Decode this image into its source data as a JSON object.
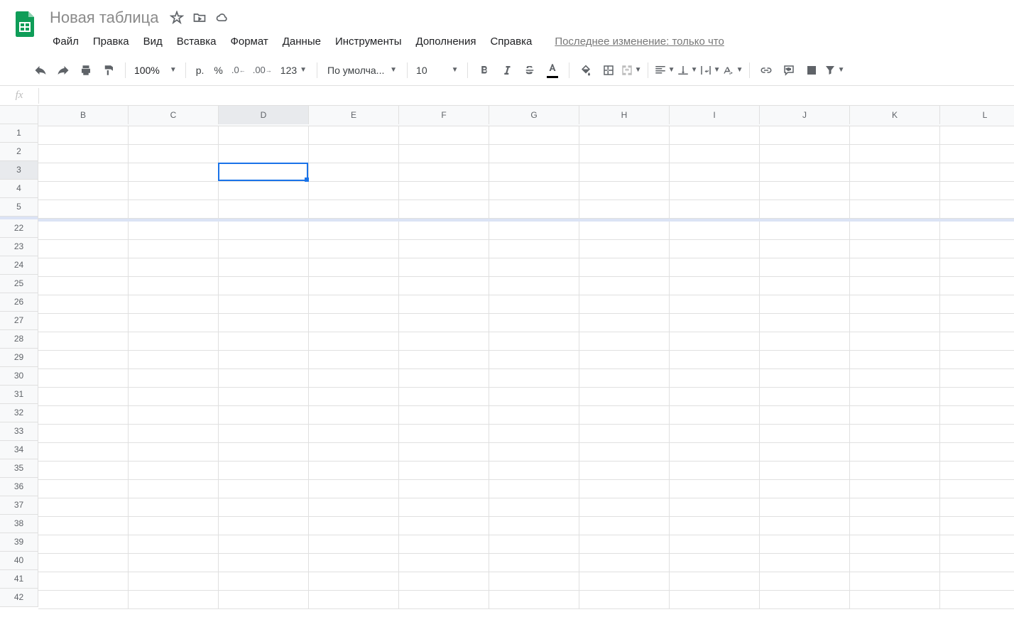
{
  "doc": {
    "title": "Новая таблица"
  },
  "menus": {
    "file": "Файл",
    "edit": "Правка",
    "view": "Вид",
    "insert": "Вставка",
    "format": "Формат",
    "data": "Данные",
    "tools": "Инструменты",
    "addons": "Дополнения",
    "help": "Справка",
    "last_change": "Последнее изменение: только что"
  },
  "toolbar": {
    "zoom": "100%",
    "currency_symbol": "р.",
    "percent": "%",
    "dec_minus": ".0",
    "dec_plus": ".00",
    "num_format": "123",
    "font_name": "По умолча...",
    "font_size": "10"
  },
  "fx": {
    "label": "fx",
    "value": ""
  },
  "columns": [
    "B",
    "C",
    "D",
    "E",
    "F",
    "G",
    "H",
    "I",
    "J",
    "K",
    "L"
  ],
  "rows_top": [
    "1",
    "2",
    "3",
    "4",
    "5"
  ],
  "rows_bottom": [
    "22",
    "23",
    "24",
    "25",
    "26",
    "27",
    "28",
    "29",
    "30",
    "31",
    "32",
    "33",
    "34",
    "35",
    "36",
    "37",
    "38",
    "39",
    "40",
    "41",
    "42"
  ],
  "active": {
    "col": "D",
    "row": "3",
    "col_index": 2,
    "row_index_in_top": 2
  }
}
